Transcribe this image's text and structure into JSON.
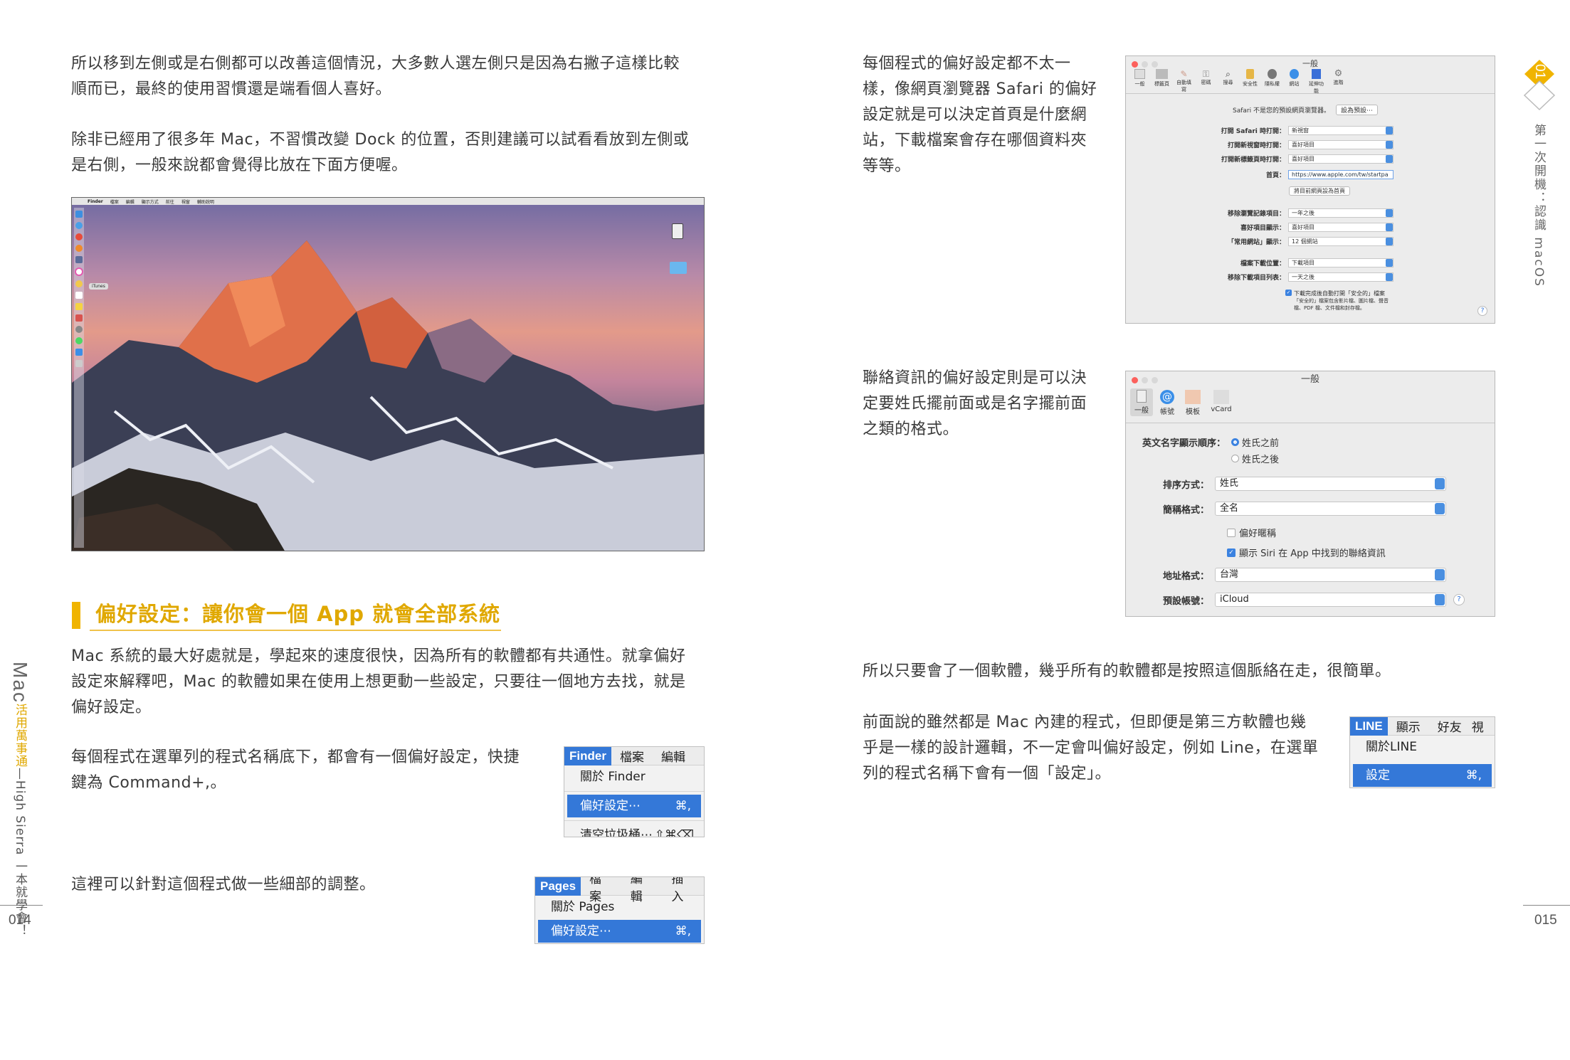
{
  "left_page": {
    "para1": [
      "所以移到左側或是右側都可以改善這個情況，大多數人選左側只是因為右撇子這樣比較",
      "順而已，最終的使用習慣還是端看個人喜好。"
    ],
    "para2": [
      "除非已經用了很多年 Mac，不習慣改變 Dock 的位置，否則建議可以試看看放到左側或",
      "是右側，一般來說都會覺得比放在下面方便喔。"
    ],
    "section_heading": "偏好設定：讓你會一個 App 就會全部系統",
    "para3": [
      "Mac 系統的最大好處就是，學起來的速度很快，因為所有的軟體都有共通性。就拿偏好",
      "設定來解釋吧，Mac 的軟體如果在使用上想更動一些設定，只要往一個地方去找，就是",
      "偏好設定。"
    ],
    "para4": [
      "每個程式在選單列的程式名稱底下，都會有一個偏好設定，快捷",
      "鍵為 Command+,。"
    ],
    "para5": "這裡可以針對這個程式做一些細部的調整。",
    "page_number": "014",
    "sidebar_mac": "Mac",
    "sidebar_brand": "活用萬事通",
    "sidebar_rest": "—High Sierra 一本就學會！",
    "desktop": {
      "menubar_items": [
        "Finder",
        "檔案",
        "編輯",
        "顯示方式",
        "前往",
        "視窗",
        "輔助說明"
      ],
      "dock_itunes_label": "iTunes"
    },
    "finder_menu": {
      "app": "Finder",
      "menus": [
        "檔案",
        "編輯"
      ],
      "items": [
        {
          "label": "關於 Finder",
          "shortcut": ""
        },
        {
          "label": "偏好設定⋯",
          "shortcut": "⌘,"
        },
        {
          "label": "清空垃圾桶⋯",
          "shortcut": "⇧⌘⌫"
        }
      ]
    },
    "pages_menu": {
      "app": "Pages",
      "menus": [
        "檔案",
        "編輯",
        "插入"
      ],
      "items": [
        {
          "label": "關於 Pages",
          "shortcut": ""
        },
        {
          "label": "偏好設定⋯",
          "shortcut": "⌘,"
        }
      ]
    }
  },
  "right_page": {
    "para1": [
      "每個程式的偏好設定都不太一",
      "樣，像網頁瀏覽器 Safari 的偏好",
      "設定就是可以決定首頁是什麼網",
      "站，下載檔案會存在哪個資料夾",
      "等等。"
    ],
    "para2": [
      "聯絡資訊的偏好設定則是可以決",
      "定要姓氏擺前面或是名字擺前面",
      "之類的格式。"
    ],
    "para3": "所以只要會了一個軟體，幾乎所有的軟體都是按照這個脈絡在走，很簡單。",
    "para4": [
      "前面說的雖然都是 Mac 內建的程式，但即便是第三方軟體也幾",
      "乎是一樣的設計邏輯，不一定會叫偏好設定，例如 Line，在選單",
      "列的程式名稱下會有一個「設定」。"
    ],
    "page_number": "015",
    "chapter_badge": "01",
    "sidebar_text": "第一次開機：認識 macOS",
    "safari_prefs": {
      "title": "一般",
      "toolbar": [
        "一般",
        "標籤頁",
        "自動填寫",
        "密碼",
        "搜尋",
        "安全性",
        "隱私權",
        "網站",
        "延伸功能",
        "進階"
      ],
      "default_browser_text": "Safari 不是您的預設網頁瀏覽器。",
      "default_browser_button": "設為預設⋯",
      "rows": [
        {
          "label": "打開 Safari 時打開：",
          "value": "新視窗"
        },
        {
          "label": "打開新視窗時打開：",
          "value": "喜好項目"
        },
        {
          "label": "打開新標籤頁時打開：",
          "value": "喜好項目"
        },
        {
          "label": "首頁：",
          "value": "https://www.apple.com/tw/startpa"
        }
      ],
      "set_current_button": "將目前網頁設為首頁",
      "rows2": [
        {
          "label": "移除瀏覽記錄項目：",
          "value": "一年之後"
        },
        {
          "label": "喜好項目顯示：",
          "value": "喜好項目"
        },
        {
          "label": "「常用網站」顯示：",
          "value": "12 個網站"
        }
      ],
      "rows3": [
        {
          "label": "檔案下載位置：",
          "value": "下載項目"
        },
        {
          "label": "移除下載項目列表：",
          "value": "一天之後"
        }
      ],
      "checkbox_label": "下載完成後自動打開「安全的」檔案",
      "checkbox_note1": "「安全的」檔案包含影片檔、圖片檔、聲音",
      "checkbox_note2": "檔、PDF 檔、文件檔和封存檔。",
      "help": "?"
    },
    "contacts_prefs": {
      "title": "一般",
      "toolbar": [
        "一般",
        "帳號",
        "模板",
        "vCard"
      ],
      "name_order_label": "英文名字顯示順序：",
      "name_order_options": [
        "姓氏之前",
        "姓氏之後"
      ],
      "rows": [
        {
          "label": "排序方式：",
          "value": "姓氏"
        },
        {
          "label": "簡稱格式：",
          "value": "全名"
        }
      ],
      "prefer_nickname": "偏好暱稱",
      "show_siri": "顯示 Siri 在 App 中找到的聯絡資訊",
      "rows2": [
        {
          "label": "地址格式：",
          "value": "台灣"
        },
        {
          "label": "預設帳號：",
          "value": "iCloud"
        }
      ],
      "help": "?"
    },
    "line_menu": {
      "app": "LINE",
      "menus": [
        "顯示",
        "好友",
        "視"
      ],
      "items": [
        {
          "label": "關於LINE",
          "shortcut": ""
        },
        {
          "label": "設定",
          "shortcut": "⌘,"
        }
      ]
    }
  },
  "colors": {
    "accent": "#f0b400",
    "heading": "#e0a800",
    "menu_highlight": "#3478d8"
  }
}
